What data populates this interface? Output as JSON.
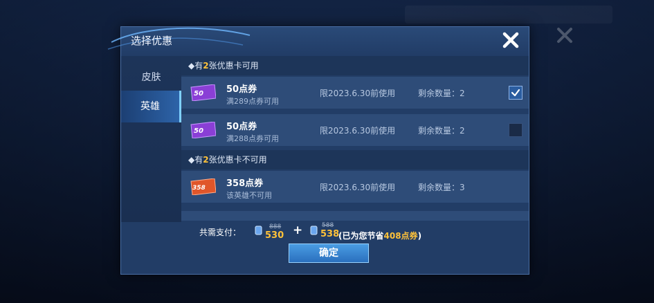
{
  "dialog": {
    "title": "选择优惠",
    "close_icon": "close-x-icon"
  },
  "sidebar": {
    "tabs": [
      {
        "label": "皮肤",
        "active": false
      },
      {
        "label": "英雄",
        "active": true
      }
    ]
  },
  "available_section": {
    "prefix": "◆有",
    "count": "2",
    "suffix": "张优惠卡可用",
    "coupons": [
      {
        "ticket_value": "50",
        "ticket_color": "#8a3fd6",
        "name": "50点券",
        "condition": "满289点券可用",
        "expiry": "限2023.6.30前使用",
        "remaining": "剩余数量：2",
        "checked": true
      },
      {
        "ticket_value": "50",
        "ticket_color": "#8a3fd6",
        "name": "50点券",
        "condition": "满288点券可用",
        "expiry": "限2023.6.30前使用",
        "remaining": "剩余数量：2",
        "checked": false
      }
    ]
  },
  "unavailable_section": {
    "prefix": "◆有",
    "count": "2",
    "suffix": "张优惠卡不可用",
    "coupons": [
      {
        "ticket_value": "358",
        "ticket_color": "#e0562a",
        "name": "358点券",
        "condition": "该英雄不可用",
        "expiry": "限2023.6.30前使用",
        "remaining": "剩余数量：3"
      }
    ]
  },
  "footer": {
    "total_label": "共需支付：",
    "price1_old": "888",
    "price1_new": "530",
    "plus": "+",
    "price2_old": "588",
    "price2_new": "538",
    "saved_prefix": "(已为您节省",
    "saved_amount": "408点券",
    "saved_suffix": ")",
    "confirm_label": "确定"
  },
  "colors": {
    "accent_gold": "#ffc23a",
    "dialog_bg": "#223d66",
    "confirm_bg": "#3a88d4"
  }
}
